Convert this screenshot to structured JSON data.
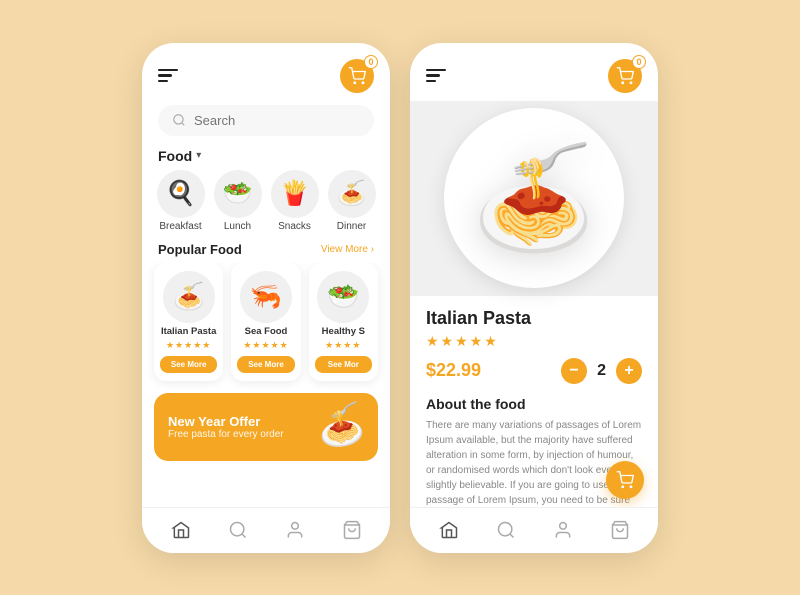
{
  "app": {
    "accent_color": "#f5a623",
    "bg_color": "#f5d9a8"
  },
  "left_phone": {
    "cart_badge": "0",
    "search_placeholder": "Search",
    "food_section": {
      "label": "Food",
      "chevron": "▾"
    },
    "categories": [
      {
        "id": "breakfast",
        "label": "Breakfast",
        "emoji": "🍳"
      },
      {
        "id": "lunch",
        "label": "Lunch",
        "emoji": "🥗"
      },
      {
        "id": "snacks",
        "label": "Snacks",
        "emoji": "🍟"
      },
      {
        "id": "dinner",
        "label": "Dinner",
        "emoji": "🍝"
      }
    ],
    "popular": {
      "title": "Popular Food",
      "view_more": "View More ›"
    },
    "food_cards": [
      {
        "name": "Italian Pasta",
        "emoji": "🍝",
        "stars": "★★★★★",
        "see_more": "See More"
      },
      {
        "name": "Sea Food",
        "emoji": "🦐",
        "stars": "★★★★★",
        "see_more": "See More"
      },
      {
        "name": "Healthy S",
        "emoji": "🥗",
        "stars": "★★★★",
        "see_more": "See Mor"
      }
    ],
    "promo": {
      "title": "New Year Offer",
      "subtitle": "Free pasta for every order",
      "emoji": "🍝"
    }
  },
  "right_phone": {
    "cart_badge": "0",
    "food_name": "Italian Pasta",
    "stars": "★★★★★",
    "price": "$22.99",
    "quantity": "2",
    "about_title": "About the food",
    "about_text": "There are many variations of passages of Lorem Ipsum available, but the majority have suffered alteration in some form, by injection of humour, or randomised words which don't look even slightly believable. If you are going to use a passage of Lorem Ipsum, you need to be sure",
    "minus_label": "−",
    "plus_label": "+"
  },
  "bottom_nav": {
    "items": [
      {
        "id": "home",
        "label": "Home"
      },
      {
        "id": "search",
        "label": "Search"
      },
      {
        "id": "profile",
        "label": "Profile"
      },
      {
        "id": "bag",
        "label": "Bag"
      }
    ]
  }
}
